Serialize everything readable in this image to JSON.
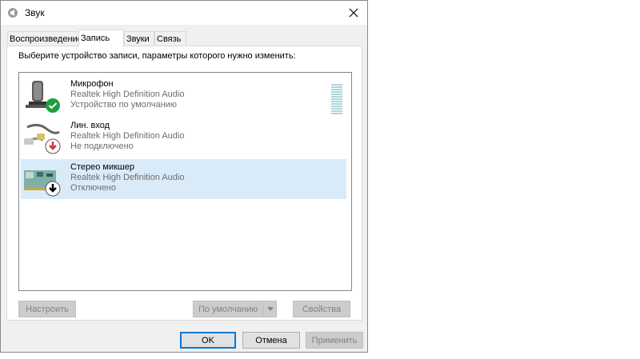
{
  "window": {
    "title": "Звук"
  },
  "tabs": [
    {
      "label": "Воспроизведение"
    },
    {
      "label": "Запись",
      "active": true
    },
    {
      "label": "Звуки"
    },
    {
      "label": "Связь"
    }
  ],
  "instruction": "Выберите устройство записи, параметры которого нужно изменить:",
  "devices": [
    {
      "name": "Микрофон",
      "driver": "Realtek High Definition Audio",
      "status": "Устройство по умолчанию",
      "icon": "microphone-icon",
      "badge": "default-check-icon",
      "level": 0.9
    },
    {
      "name": "Лин. вход",
      "driver": "Realtek High Definition Audio",
      "status": "Не подключено",
      "icon": "line-in-cable-icon",
      "badge": "unplugged-arrow-icon"
    },
    {
      "name": "Стерео микшер",
      "driver": "Realtek High Definition Audio",
      "status": "Отключено",
      "icon": "sound-card-icon",
      "badge": "disabled-arrow-icon",
      "selected": true
    }
  ],
  "buttons": {
    "configure": "Настроить",
    "set_default": "По умолчанию",
    "properties": "Свойства",
    "ok": "OK",
    "cancel": "Отмена",
    "apply": "Применить"
  },
  "colors": {
    "selection": "#d9ebf9",
    "level_meter": "#a8d8dc",
    "default_badge": "#1c9e3c",
    "unplugged_badge": "#d32f2f",
    "focus_border": "#0078d7"
  }
}
